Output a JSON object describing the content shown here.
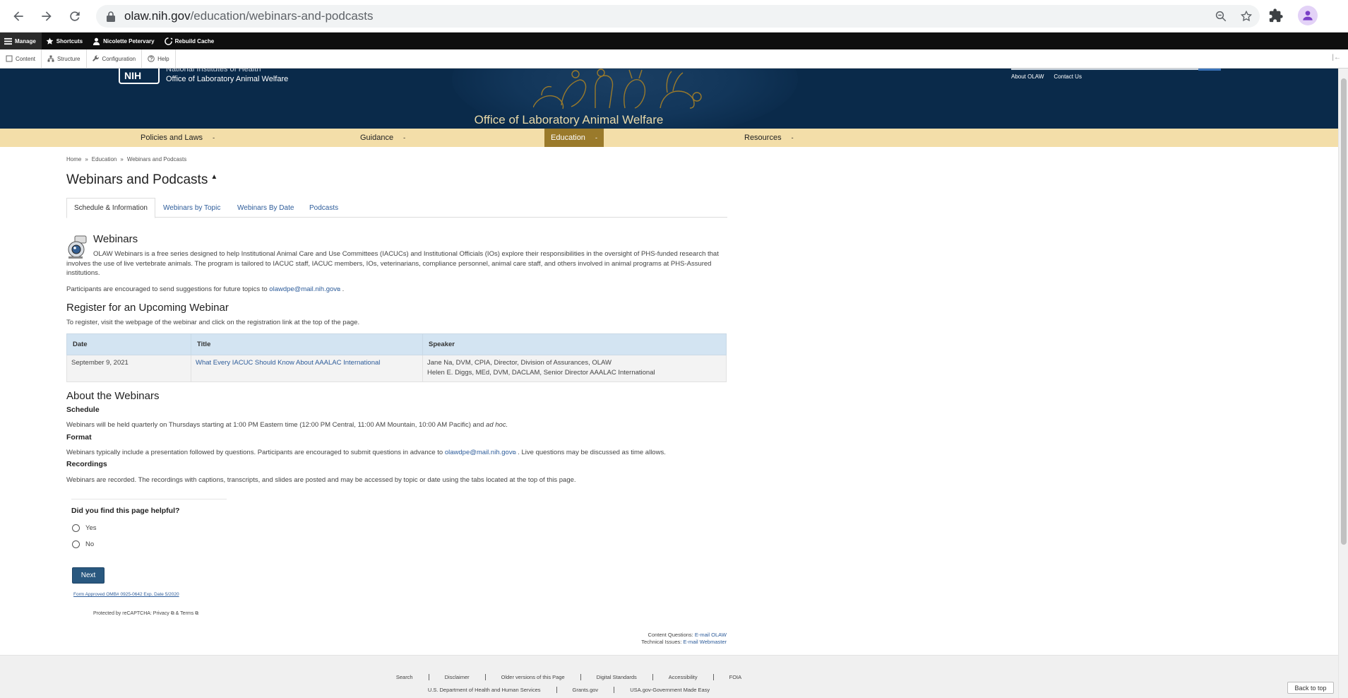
{
  "browser": {
    "url_host": "olaw.nih.gov",
    "url_path": "/education/webinars-and-podcasts"
  },
  "admin_toolbar": {
    "items": [
      "Manage",
      "Shortcuts",
      "Nicolette Petervary",
      "Rebuild Cache"
    ],
    "sub_items": [
      "Content",
      "Structure",
      "Configuration",
      "Help"
    ]
  },
  "header": {
    "logo_text": "NIH",
    "org_line1": "National Institutes of Health",
    "org_line2": "Office of Laboratory Animal Welfare",
    "site_title": "Office of Laboratory Animal Welfare",
    "links": [
      "About OLAW",
      "Contact Us"
    ]
  },
  "nav": {
    "items": [
      "Policies and Laws",
      "Guidance",
      "Education",
      "Resources"
    ],
    "active": "Education",
    "caret": "-"
  },
  "breadcrumb": [
    "Home",
    "Education",
    "Webinars and Podcasts"
  ],
  "breadcrumb_sep": "»",
  "page_title": "Webinars and Podcasts",
  "tabs": [
    "Schedule & Information",
    "Webinars by Topic",
    "Webinars By Date",
    "Podcasts"
  ],
  "webinars": {
    "heading": "Webinars",
    "intro": "OLAW Webinars is a free series designed to help Institutional Animal Care and Use Committees (IACUCs) and Institutional Officials (IOs) explore their responsibilities in the oversight of PHS-funded research that involves the use of live vertebrate animals. The program is tailored to IACUC staff, IACUC members, IOs, veterinarians, compliance personnel, animal care staff, and others involved in animal programs at PHS-Assured institutions.",
    "participants_prefix": "Participants are encouraged to send suggestions for future topics to ",
    "email": "olawdpe@mail.nih.gov",
    "participants_suffix": " ."
  },
  "register": {
    "heading": "Register for an Upcoming Webinar",
    "text": "To register, visit the webpage of the webinar and click on the registration link at the top of the page.",
    "columns": [
      "Date",
      "Title",
      "Speaker"
    ],
    "row": {
      "date": "September 9, 2021",
      "title": "What Every IACUC Should Know About AAALAC International",
      "speaker1": "Jane Na, DVM, CPIA, Director, Division of Assurances, OLAW",
      "speaker2": "Helen E. Diggs, MEd, DVM, DACLAM, Senior Director AAALAC International"
    }
  },
  "about": {
    "heading": "About the Webinars",
    "schedule_h": "Schedule",
    "schedule_text": "Webinars will be held quarterly on Thursdays starting at 1:00 PM Eastern time (12:00 PM Central, 11:00 AM Mountain, 10:00 AM Pacific) and ",
    "schedule_italic": "ad hoc.",
    "format_h": "Format",
    "format_prefix": "Webinars typically include a presentation followed by questions. Participants are encouraged to submit questions in advance to ",
    "format_email": "olawdpe@mail.nih.gov",
    "format_suffix": " . Live questions may be discussed as time allows.",
    "recordings_h": "Recordings",
    "recordings_text": "Webinars are recorded. The recordings with captions, transcripts, and slides are posted and may be accessed by topic or date using the tabs located at the top of this page."
  },
  "feedback": {
    "question": "Did you find this page helpful?",
    "yes": "Yes",
    "no": "No",
    "next": "Next",
    "form_approved": "Form Approved OMB# 0925-0642 Exp. Date 5/2020",
    "recaptcha": "Protected by reCAPTCHA: Privacy",
    "recaptcha_and": " & Terms"
  },
  "contact": {
    "content_label": "Content Questions: ",
    "content_link": "E-mail OLAW",
    "tech_label": "Technical Issues: ",
    "tech_link": "E-mail Webmaster"
  },
  "footer": {
    "row1": [
      "Search",
      "Disclaimer",
      "Older versions of this Page",
      "Digital Standards",
      "Accessibility",
      "FOIA"
    ],
    "row2": [
      "U.S. Department of Health and Human Services",
      "Grants.gov",
      "USA.gov-Government Made Easy"
    ],
    "back_to_top": "Back to top"
  },
  "colors": {
    "header_bg": "#0a2a4a",
    "nav_bg": "#f3dea9",
    "nav_active": "#9a7a2b",
    "link": "#2d5c9a",
    "button": "#29587f"
  }
}
